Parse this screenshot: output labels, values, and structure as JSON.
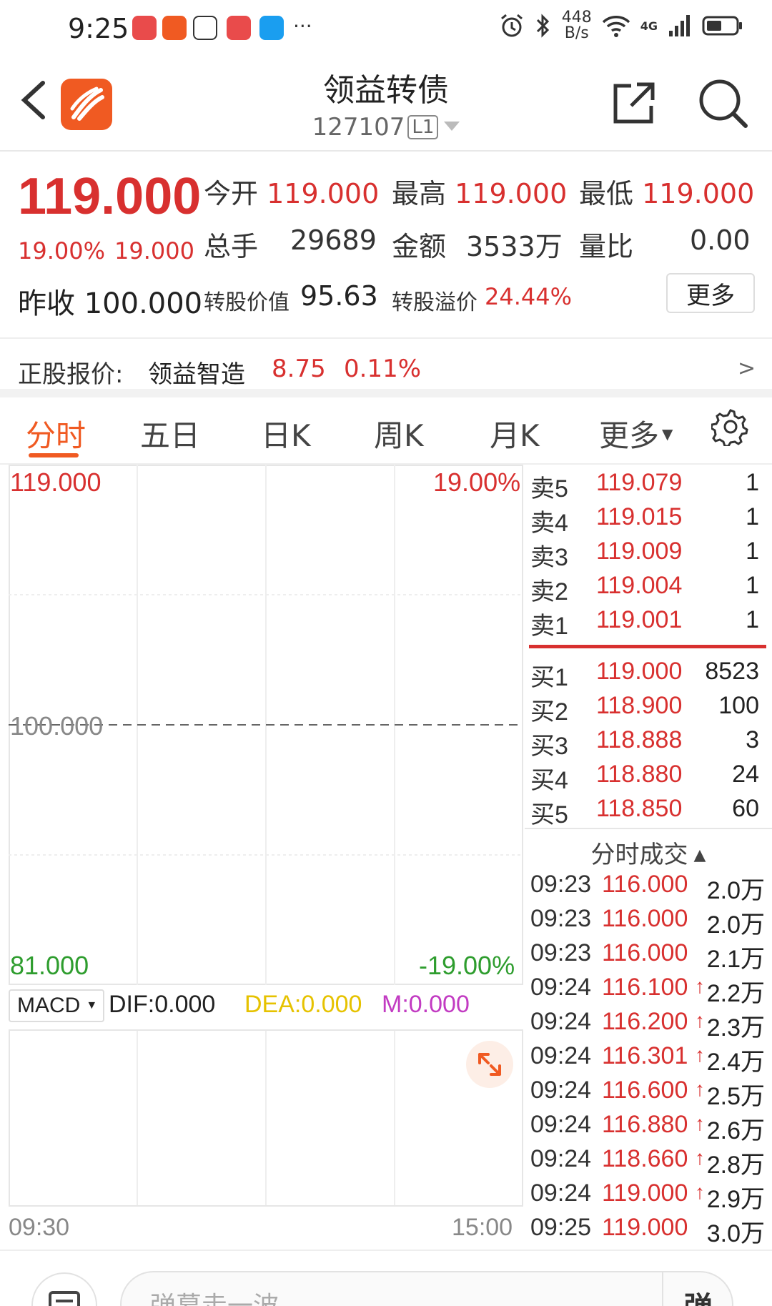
{
  "status": {
    "time": "9:25",
    "speed_value": "448",
    "speed_unit": "B/s",
    "network": "4G",
    "ellipsis": "···"
  },
  "header": {
    "title": "领益转债",
    "code": "127107",
    "level": "L1"
  },
  "quote": {
    "last_price": "119.000",
    "change_pct": "19.00%",
    "change_abs": "19.000",
    "open_label": "今开",
    "open": "119.000",
    "high_label": "最高",
    "high": "119.000",
    "low_label": "最低",
    "low": "119.000",
    "volume_label": "总手",
    "volume": "29689",
    "amount_label": "金额",
    "amount": "3533万",
    "ratio_label": "量比",
    "ratio": "0.00",
    "prev_close_label": "昨收",
    "prev_close": "100.000",
    "conv_value_label": "转股价值",
    "conv_value": "95.63",
    "conv_premium_label": "转股溢价",
    "conv_premium": "24.44%",
    "more_label": "更多"
  },
  "underlying": {
    "label": "正股报价:",
    "name": "领益智造",
    "price": "8.75",
    "pct": "0.11%",
    "arrow": ">"
  },
  "tabs": [
    {
      "label": "分时"
    },
    {
      "label": "五日"
    },
    {
      "label": "日K"
    },
    {
      "label": "周K"
    },
    {
      "label": "月K"
    },
    {
      "label": "更多"
    }
  ],
  "chart": {
    "top_price": "119.000",
    "top_pct": "19.00%",
    "mid_price": "100.000",
    "bottom_price": "81.000",
    "bottom_pct": "-19.00%",
    "time_start": "09:30",
    "time_end": "15:00"
  },
  "macd": {
    "select": "MACD",
    "dif": "DIF:0.000",
    "dea": "DEA:0.000",
    "m": "M:0.000",
    "dea_color": "#e6c200",
    "m_color": "#c23bc2"
  },
  "order_book": {
    "asks": [
      {
        "label": "卖5",
        "price": "119.079",
        "vol": "1"
      },
      {
        "label": "卖4",
        "price": "119.015",
        "vol": "1"
      },
      {
        "label": "卖3",
        "price": "119.009",
        "vol": "1"
      },
      {
        "label": "卖2",
        "price": "119.004",
        "vol": "1"
      },
      {
        "label": "卖1",
        "price": "119.001",
        "vol": "1"
      }
    ],
    "bids": [
      {
        "label": "买1",
        "price": "119.000",
        "vol": "8523"
      },
      {
        "label": "买2",
        "price": "118.900",
        "vol": "100"
      },
      {
        "label": "买3",
        "price": "118.888",
        "vol": "3"
      },
      {
        "label": "买4",
        "price": "118.880",
        "vol": "24"
      },
      {
        "label": "买5",
        "price": "118.850",
        "vol": "60"
      }
    ]
  },
  "ticks": {
    "header": "分时成交",
    "rows": [
      {
        "time": "09:23",
        "price": "116.000",
        "arrow": "",
        "vol": "2.0万"
      },
      {
        "time": "09:23",
        "price": "116.000",
        "arrow": "",
        "vol": "2.0万"
      },
      {
        "time": "09:23",
        "price": "116.000",
        "arrow": "",
        "vol": "2.1万"
      },
      {
        "time": "09:24",
        "price": "116.100",
        "arrow": "↑",
        "vol": "2.2万"
      },
      {
        "time": "09:24",
        "price": "116.200",
        "arrow": "↑",
        "vol": "2.3万"
      },
      {
        "time": "09:24",
        "price": "116.301",
        "arrow": "↑",
        "vol": "2.4万"
      },
      {
        "time": "09:24",
        "price": "116.600",
        "arrow": "↑",
        "vol": "2.5万"
      },
      {
        "time": "09:24",
        "price": "116.880",
        "arrow": "↑",
        "vol": "2.6万"
      },
      {
        "time": "09:24",
        "price": "118.660",
        "arrow": "↑",
        "vol": "2.8万"
      },
      {
        "time": "09:24",
        "price": "119.000",
        "arrow": "↑",
        "vol": "2.9万"
      },
      {
        "time": "09:25",
        "price": "119.000",
        "arrow": "",
        "vol": "3.0万"
      }
    ]
  },
  "bottom": {
    "input_placeholder": "弹幕走一波",
    "toggle_label": "弹"
  },
  "colors": {
    "up": "#d8302f",
    "down": "#2e9d2e",
    "accent": "#f05a22"
  }
}
